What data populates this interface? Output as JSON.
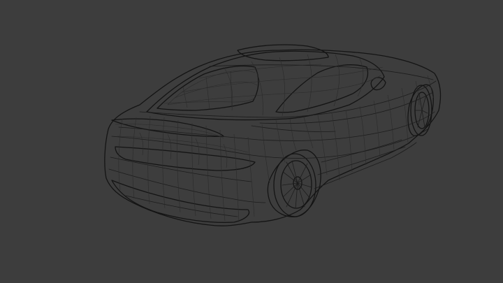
{
  "viewport": {
    "background_color": "#3d3d3d",
    "mesh_fill_color": "#d8e0e0",
    "wire_color": "#1c1c1c",
    "mesh_fill_dark": "#c4cccc",
    "subject": "car-wireframe-model"
  }
}
